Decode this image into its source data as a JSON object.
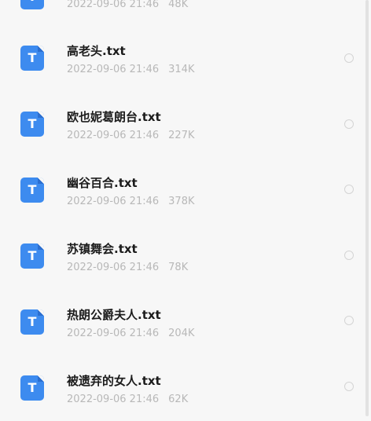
{
  "files": [
    {
      "name": "",
      "date": "2022-09-06 21:46",
      "size": "48K"
    },
    {
      "name": "高老头.txt",
      "date": "2022-09-06 21:46",
      "size": "314K"
    },
    {
      "name": "欧也妮葛朗台.txt",
      "date": "2022-09-06 21:46",
      "size": "227K"
    },
    {
      "name": "幽谷百合.txt",
      "date": "2022-09-06 21:46",
      "size": "378K"
    },
    {
      "name": "苏镇舞会.txt",
      "date": "2022-09-06 21:46",
      "size": "78K"
    },
    {
      "name": "热朗公爵夫人.txt",
      "date": "2022-09-06 21:46",
      "size": "204K"
    },
    {
      "name": "被遗弃的女人.txt",
      "date": "2022-09-06 21:46",
      "size": "62K"
    }
  ],
  "icon": {
    "glyph": "T",
    "name": "text-file-icon",
    "color": "#3d8bef"
  },
  "colors": {
    "background": "#f7f7f7",
    "name_text": "#1c1c1c",
    "meta_text": "#b8b8b8"
  }
}
